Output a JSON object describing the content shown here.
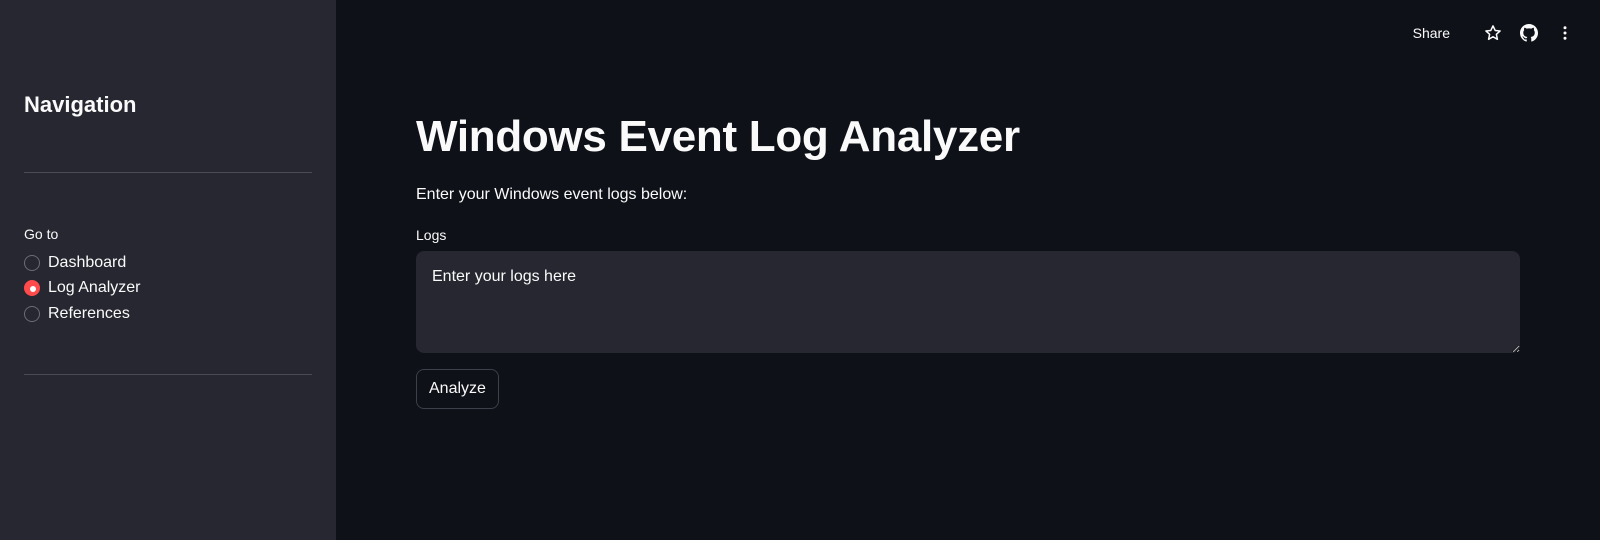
{
  "sidebar": {
    "title": "Navigation",
    "radio_group_label": "Go to",
    "options": [
      {
        "label": "Dashboard",
        "selected": false
      },
      {
        "label": "Log Analyzer",
        "selected": true
      },
      {
        "label": "References",
        "selected": false
      }
    ]
  },
  "toolbar": {
    "share_label": "Share",
    "icons": [
      "star-icon",
      "github-icon",
      "more-vertical-icon"
    ]
  },
  "main": {
    "title": "Windows Event Log Analyzer",
    "intro": "Enter your Windows event logs below:",
    "logs_label": "Logs",
    "logs_value": "",
    "logs_placeholder": "Enter your logs here",
    "analyze_label": "Analyze"
  },
  "colors": {
    "background": "#0e1117",
    "sidebar": "#262730",
    "accent": "#ff4b4b",
    "text": "#fafafa"
  }
}
